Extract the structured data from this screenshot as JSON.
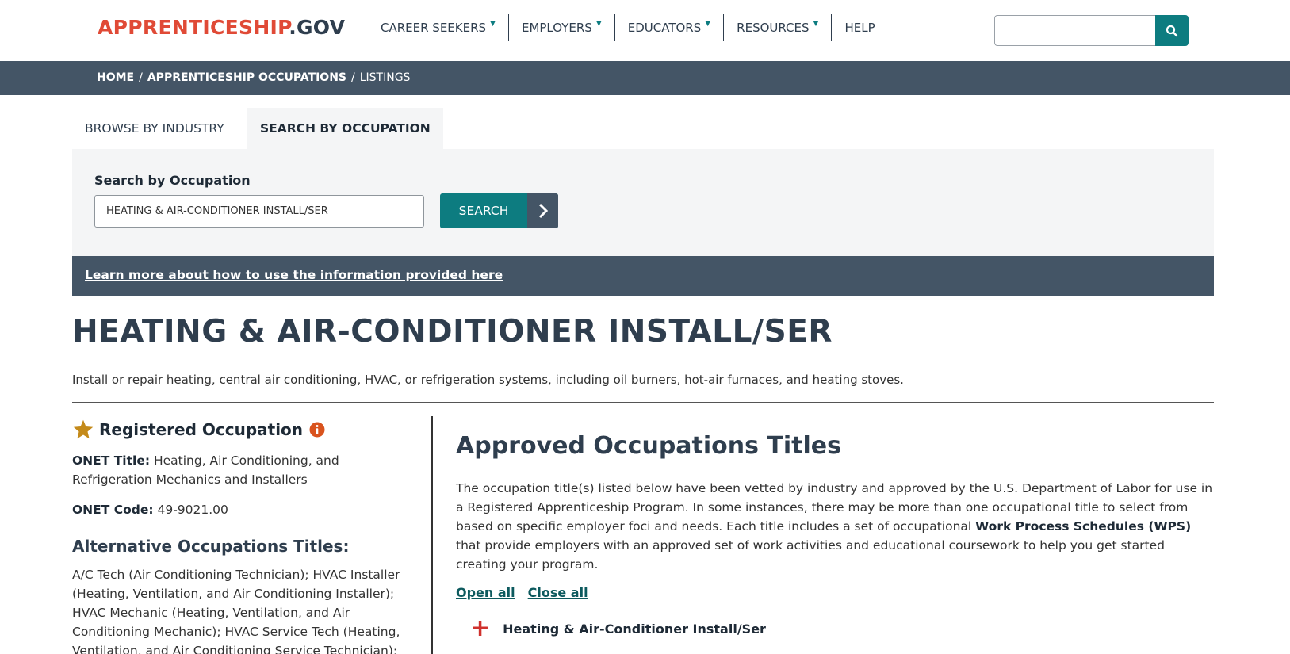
{
  "header": {
    "logo_part1": "APPRENTICESHIP",
    "logo_part2": ".GOV",
    "nav": [
      {
        "label": "CAREER SEEKERS",
        "caret": "▼"
      },
      {
        "label": "EMPLOYERS",
        "caret": "▼"
      },
      {
        "label": "EDUCATORS",
        "caret": "▼"
      },
      {
        "label": "RESOURCES",
        "caret": "▼"
      },
      {
        "label": "HELP",
        "caret": ""
      }
    ],
    "search_icon": "search-icon"
  },
  "breadcrumb": {
    "home": "HOME",
    "occupations": "APPRENTICESHIP OCCUPATIONS",
    "current": "LISTINGS",
    "sep": "/"
  },
  "tabs": {
    "browse": "BROWSE BY INDUSTRY",
    "search": "SEARCH BY OCCUPATION"
  },
  "search_panel": {
    "label": "Search by Occupation",
    "value": "HEATING & AIR-CONDITIONER INSTALL/SER",
    "button": "SEARCH"
  },
  "learn_link": "Learn more about how to use the information provided here",
  "occupation": {
    "title": "HEATING & AIR-CONDITIONER INSTALL/SER",
    "description": "Install or repair heating, central air conditioning, HVAC, or refrigeration systems, including oil burners, hot-air furnaces, and heating stoves."
  },
  "left": {
    "registered": "Registered Occupation",
    "onet_title_label": "ONET Title:",
    "onet_title": "Heating, Air Conditioning, and Refrigeration Mechanics and Installers",
    "onet_code_label": "ONET Code:",
    "onet_code": "49-9021.00",
    "alt_heading": "Alternative Occupations Titles:",
    "alt_text": "A/C Tech (Air Conditioning Technician); HVAC Installer (Heating, Ventilation, and Air Conditioning Installer); HVAC Mechanic (Heating, Ventilation, and Air Conditioning Mechanic); HVAC Service Tech (Heating, Ventilation, and Air Conditioning Service Technician);"
  },
  "right": {
    "heading": "Approved Occupations Titles",
    "body_part1": "The occupation title(s) listed below have been vetted by industry and approved by the U.S. Department of Labor for use in a Registered Apprenticeship Program. In some instances, there may be more than one occupational title to select from based on specific employer foci and needs. Each title includes a set of occupational ",
    "body_bold": "Work Process Schedules (WPS)",
    "body_part2": " that provide employers with an approved set of work activities and educational coursework to help you get started creating your program.",
    "open_all": "Open all",
    "close_all": "Close all",
    "accordion_plus": "+",
    "accordion_title": "Heating & Air-Conditioner Install/Ser"
  },
  "colors": {
    "brand_red": "#e04a36",
    "teal": "#0d7c80",
    "slate": "#445566",
    "star": "#c48a1a",
    "info": "#d9531e"
  }
}
